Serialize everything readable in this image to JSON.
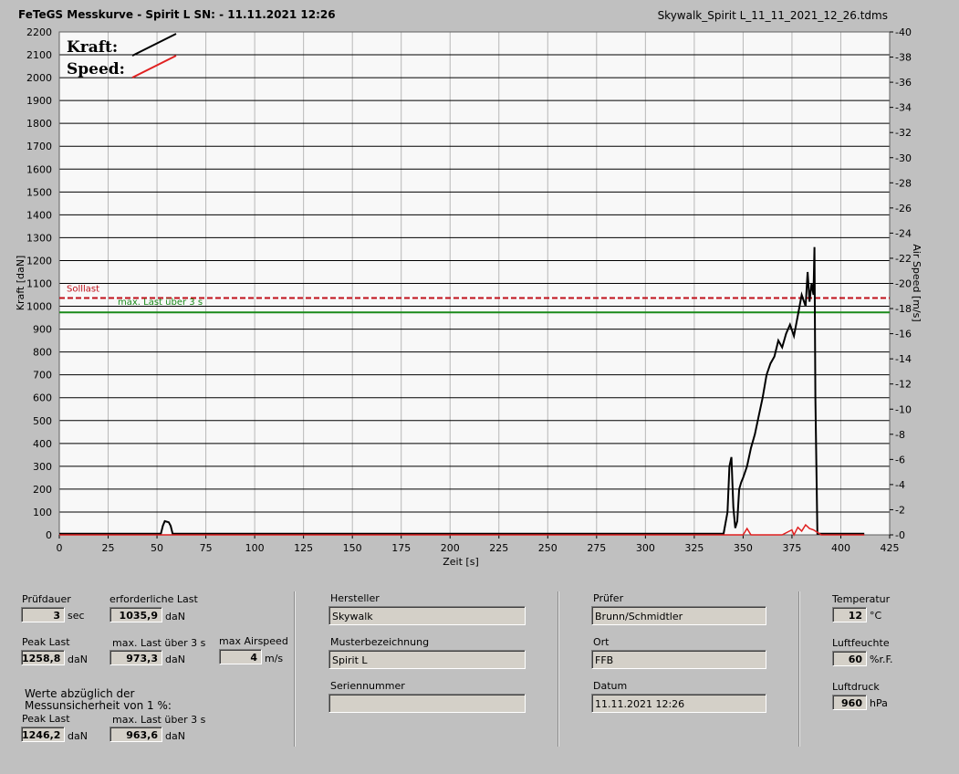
{
  "header": {
    "title": "FeTeGS Messkurve - Spirit L  SN:  - 11.11.2021 12:26",
    "filename": "Skywalk_Spirit L_11_11_2021_12_26.tdms"
  },
  "chart_data": {
    "type": "line",
    "xlabel": "Zeit [s]",
    "ylabel": "Kraft [daN]",
    "y2label": "Air Speed [m/s]",
    "xlim": [
      0,
      425
    ],
    "ylim": [
      0,
      2200
    ],
    "y2lim": [
      0,
      40
    ],
    "x_ticks": [
      0,
      25,
      50,
      75,
      100,
      125,
      150,
      175,
      200,
      225,
      250,
      275,
      300,
      325,
      350,
      375,
      400,
      425
    ],
    "y_ticks": [
      0,
      100,
      200,
      300,
      400,
      500,
      600,
      700,
      800,
      900,
      1000,
      1100,
      1200,
      1300,
      1400,
      1500,
      1600,
      1700,
      1800,
      1900,
      2000,
      2100,
      2200
    ],
    "y2_ticks": [
      0,
      2,
      4,
      6,
      8,
      10,
      12,
      14,
      16,
      18,
      20,
      22,
      24,
      26,
      28,
      30,
      32,
      34,
      36,
      38,
      40
    ],
    "grid": true,
    "legend": [
      {
        "label": "Kraft:",
        "color": "#000000"
      },
      {
        "label": "Speed:",
        "color": "#e02020"
      }
    ],
    "reference_lines": [
      {
        "label": "Solllast",
        "value": 1035.9,
        "color": "#c0101a",
        "style": "dashed"
      },
      {
        "label": "max. Last über  3 s",
        "value": 973.3,
        "color": "#1a8a1a",
        "style": "solid"
      }
    ],
    "series": [
      {
        "name": "Kraft",
        "color": "#000000",
        "x": [
          0,
          52,
          53,
          54,
          56,
          57,
          58,
          60,
          340,
          342,
          343,
          344,
          345,
          346,
          347,
          348,
          349,
          350,
          352,
          354,
          356,
          358,
          360,
          362,
          364,
          366,
          368,
          370,
          372,
          374,
          376,
          378,
          380,
          382,
          383,
          384,
          385,
          386,
          386.5,
          387,
          388,
          412
        ],
        "y": [
          5,
          5,
          40,
          60,
          55,
          40,
          5,
          5,
          5,
          100,
          300,
          340,
          120,
          30,
          60,
          200,
          230,
          250,
          300,
          380,
          440,
          520,
          600,
          700,
          750,
          780,
          850,
          820,
          880,
          920,
          870,
          960,
          1050,
          1000,
          1150,
          1020,
          1100,
          1050,
          1258.8,
          600,
          5,
          5
        ]
      },
      {
        "name": "Speed",
        "color": "#e02020",
        "x": [
          0,
          345,
          350,
          352,
          354,
          360,
          370,
          375,
          376,
          378,
          380,
          382,
          384,
          386,
          388,
          390,
          412
        ],
        "y": [
          0,
          0,
          0,
          0.5,
          0,
          0,
          0,
          0.4,
          0,
          0.6,
          0.3,
          0.8,
          0.5,
          0.4,
          0.2,
          0,
          0
        ]
      }
    ]
  },
  "panel": {
    "pruefdauer_label": "Prüfdauer",
    "pruefdauer_value": "3",
    "pruefdauer_unit": "sec",
    "erf_last_label": "erforderliche Last",
    "erf_last_value": "1035,9",
    "erf_last_unit": "daN",
    "peak_label": "Peak Last",
    "peak_value": "1258,8",
    "peak_unit": "daN",
    "max3s_label": "max. Last über  3 s",
    "max3s_value": "973,3",
    "max3s_unit": "daN",
    "airspeed_label": "max Airspeed",
    "airspeed_value": "4",
    "airspeed_unit": "m/s",
    "werte_label": "Werte abzüglich der\nMessunsicherheit von 1  %:",
    "peak2_label": "Peak Last",
    "peak2_value": "1246,2",
    "peak2_unit": "daN",
    "max3s2_label": "max. Last über  3 s",
    "max3s2_value": "963,6",
    "max3s2_unit": "daN",
    "hersteller_label": "Hersteller",
    "hersteller_value": "Skywalk",
    "muster_label": "Musterbezeichnung",
    "muster_value": "Spirit L",
    "serien_label": "Seriennummer",
    "serien_value": "",
    "pruefer_label": "Prüfer",
    "pruefer_value": "Brunn/Schmidtler",
    "ort_label": "Ort",
    "ort_value": "FFB",
    "datum_label": "Datum",
    "datum_value": "11.11.2021 12:26",
    "temp_label": "Temperatur",
    "temp_value": "12",
    "temp_unit": "°C",
    "feuchte_label": "Luftfeuchte",
    "feuchte_value": "60",
    "feuchte_unit": "%r.F.",
    "druck_label": "Luftdruck",
    "druck_value": "960",
    "druck_unit": "hPa"
  }
}
